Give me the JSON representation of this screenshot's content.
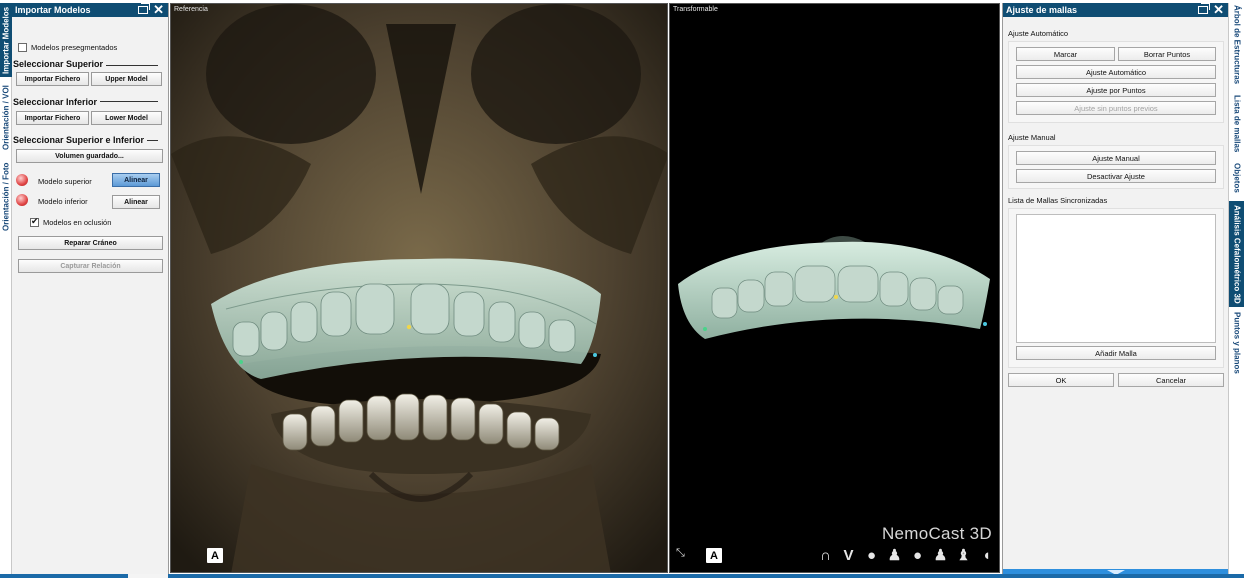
{
  "left_tabs": [
    {
      "label": "Importar Modelos",
      "active": true
    },
    {
      "label": "Orientación / VOI",
      "active": false
    },
    {
      "label": "Orientación / Foto",
      "active": false
    }
  ],
  "left_panel": {
    "title": "Importar Modelos",
    "presegmented_label": "Modelos presegmentados",
    "presegmented_checked": false,
    "upper_section": "Seleccionar Superior",
    "upper_import_button": "Importar Fichero",
    "upper_model_button": "Upper Model",
    "lower_section": "Seleccionar Inferior",
    "lower_import_button": "Importar Fichero",
    "lower_model_button": "Lower Model",
    "both_section": "Seleccionar Superior e Inferior",
    "saved_volume_button": "Volumen guardado...",
    "upper_model_label": "Modelo superior",
    "upper_align_button": "Alinear",
    "lower_model_label": "Modelo inferior",
    "lower_align_button": "Alinear",
    "occlusion_label": "Modelos en oclusión",
    "occlusion_checked": true,
    "repair_skull_button": "Reparar Cráneo",
    "capture_relation_button": "Capturar Relación"
  },
  "viewports": {
    "left_label": "Referencia",
    "right_label": "Transformable",
    "orientation_badge": "A",
    "brand": "NemoCast 3D",
    "view_icons": [
      "upper-arch-icon",
      "lower-arch-icon",
      "head-right-icon",
      "bust-icon",
      "head-left-icon",
      "bust-front-icon",
      "bust-back-icon",
      "head-reset-icon"
    ]
  },
  "right_panel": {
    "title": "Ajuste de mallas",
    "auto_section": "Ajuste Automático",
    "mark_button": "Marcar",
    "delete_points_button": "Borrar Puntos",
    "auto_adjust_button": "Ajuste Automático",
    "points_adjust_button": "Ajuste por Puntos",
    "no_prev_points_button": "Ajuste sin puntos previos",
    "manual_section": "Ajuste Manual",
    "manual_adjust_button": "Ajuste Manual",
    "deactivate_button": "Desactivar Ajuste",
    "sync_list_label": "Lista de Mallas Sincronizadas",
    "add_mesh_button": "Añadir Malla",
    "ok_button": "OK",
    "cancel_button": "Cancelar"
  },
  "right_tabs": [
    {
      "label": "Árbol de Estructuras",
      "active": false
    },
    {
      "label": "Lista de mallas",
      "active": false
    },
    {
      "label": "Objetos",
      "active": false
    },
    {
      "label": "Análisis Cefalométrico 3D",
      "active": true
    },
    {
      "label": "Puntos y planos",
      "active": false
    }
  ],
  "colors": {
    "accent": "#0f4d73",
    "align_button": "#5d9ad6"
  }
}
